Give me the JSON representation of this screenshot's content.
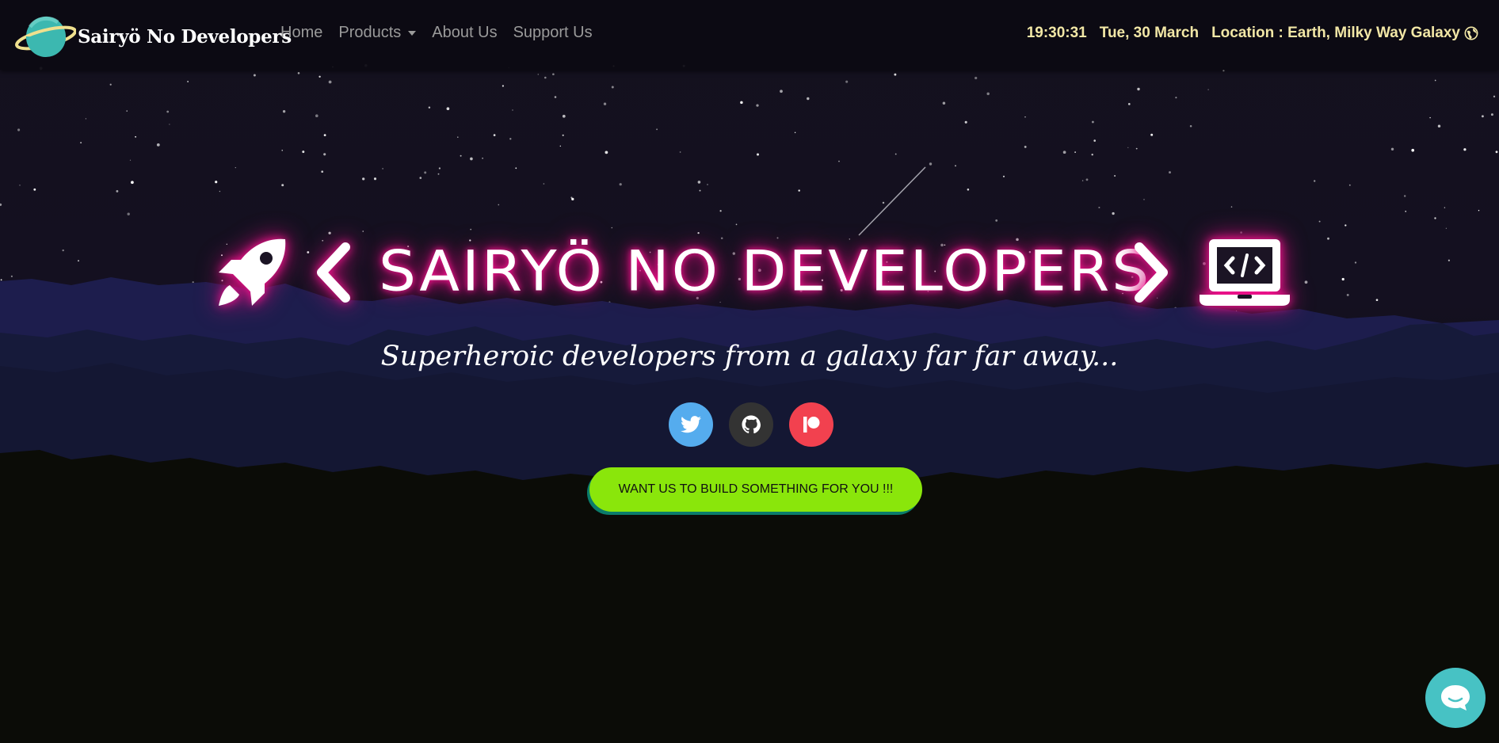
{
  "brand": {
    "name": "Sairyö No Developers"
  },
  "nav": {
    "home": "Home",
    "products": "Products",
    "about": "About Us",
    "support": "Support Us"
  },
  "info": {
    "time": "19:30:31",
    "date": "Tue, 30 March",
    "location": "Location : Earth, Milky Way Galaxy"
  },
  "hero": {
    "title": "SAIRYÖ NO DEVELOPERS",
    "subtitle": "Superheroic developers from a galaxy far far away...",
    "cta": "WANT US TO BUILD SOMETHING FOR YOU !!!"
  },
  "socials": [
    {
      "icon": "twitter-icon",
      "color": "#55acee"
    },
    {
      "icon": "github-icon",
      "color": "#333333"
    },
    {
      "icon": "patreon-icon",
      "color": "#f2414f"
    }
  ],
  "colors": {
    "accent_green": "#8ae60b",
    "neon_pink": "#ff1493",
    "info_yellow": "#f2e7a6",
    "chat_teal": "#47c2c4"
  },
  "icons": [
    "planet-icon",
    "rocket-icon",
    "chevron-left-icon",
    "chevron-right-icon",
    "laptop-code-icon",
    "globe-icon",
    "chat-icon"
  ]
}
